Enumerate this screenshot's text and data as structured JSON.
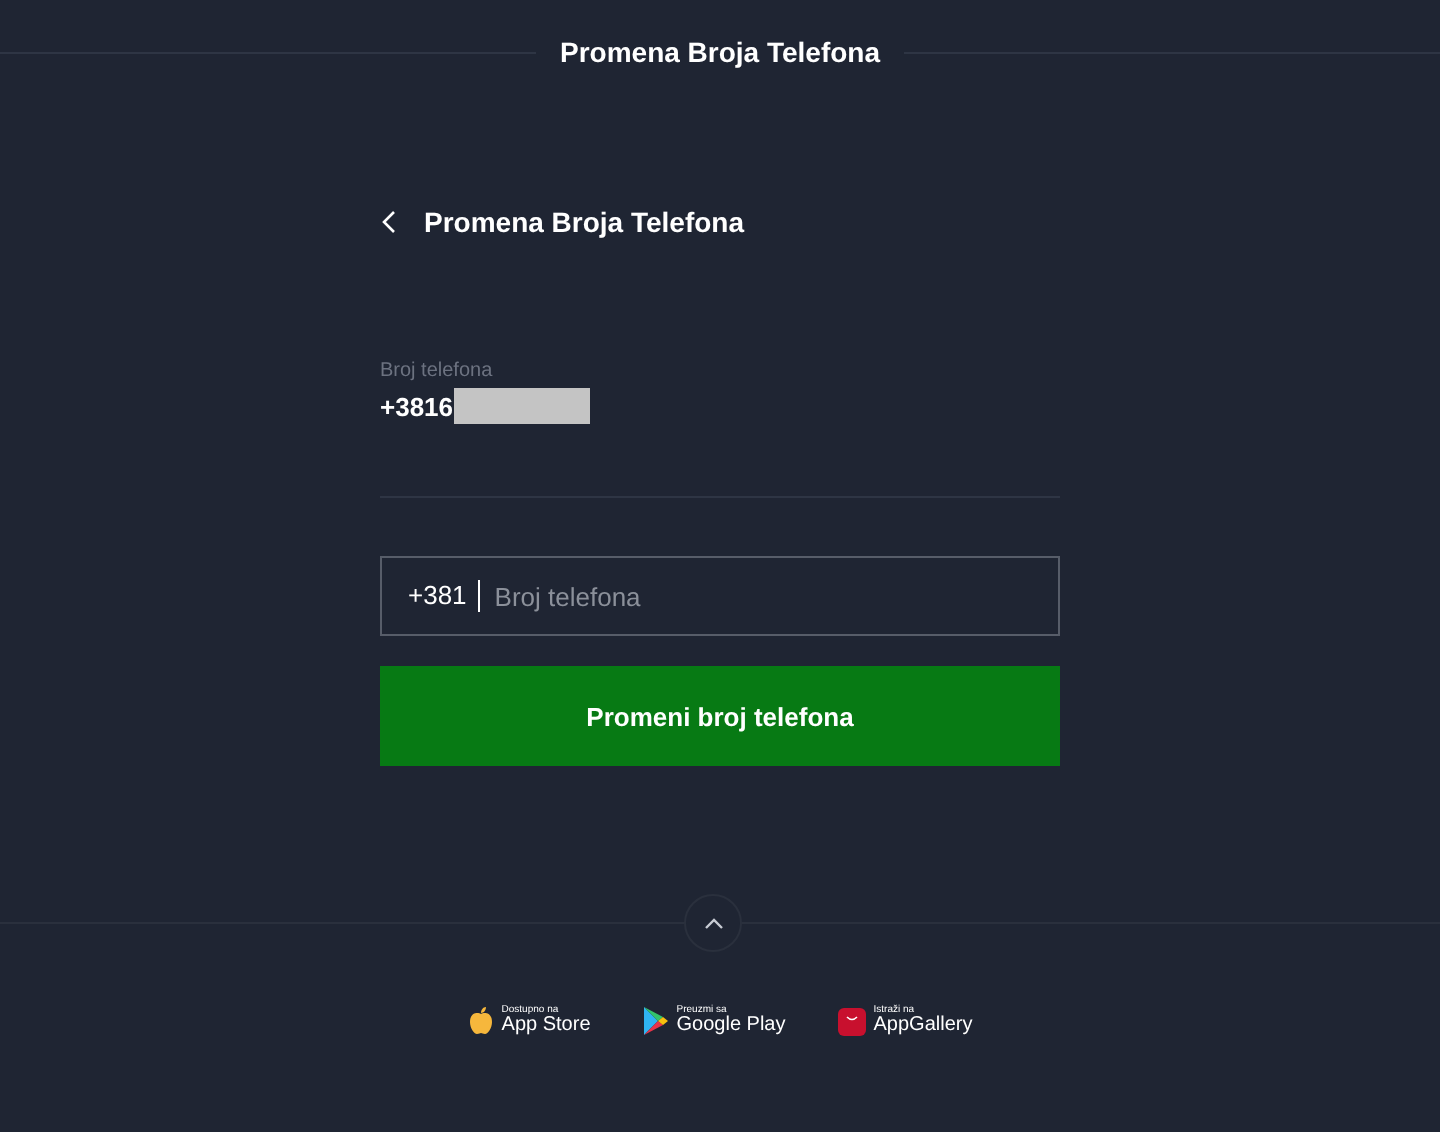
{
  "header": {
    "title": "Promena Broja Telefona"
  },
  "page": {
    "title": "Promena Broja Telefona"
  },
  "current_phone": {
    "label": "Broj telefona",
    "value": "+3816",
    "redacted": true
  },
  "phone_input": {
    "prefix": "+381",
    "placeholder": "Broj telefona"
  },
  "submit_button": {
    "label": "Promeni broj telefona"
  },
  "stores": [
    {
      "kind": "apple",
      "caption": "Dostupno na",
      "name": "App Store"
    },
    {
      "kind": "google",
      "caption": "Preuzmi sa",
      "name": "Google Play"
    },
    {
      "kind": "huawei",
      "caption": "Istraži na",
      "name": "AppGallery"
    }
  ]
}
